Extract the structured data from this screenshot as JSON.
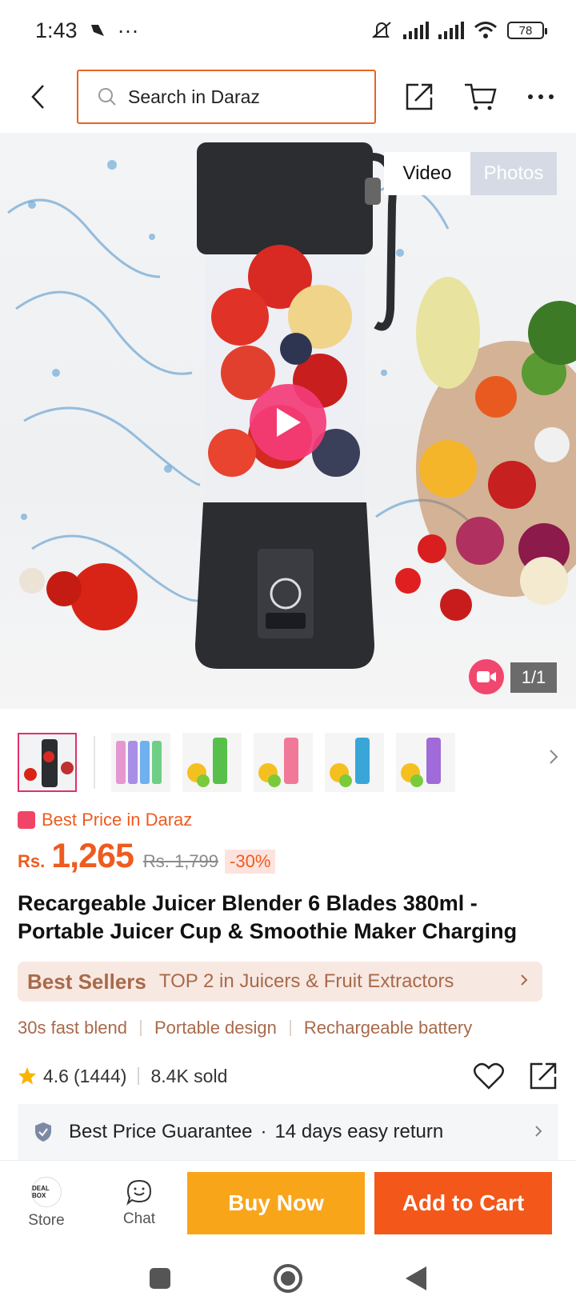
{
  "status_bar": {
    "time": "1:43",
    "dots": "···",
    "battery": "78"
  },
  "search": {
    "placeholder": "Search in Daraz"
  },
  "media": {
    "tab_video": "Video",
    "tab_photos": "Photos",
    "counter": "1/1"
  },
  "price_tag": "Best Price in Daraz",
  "price": {
    "currency": "Rs.",
    "current": "1,265",
    "original": "Rs. 1,799",
    "discount": "-30%"
  },
  "product": {
    "title": "Recargeable Juicer Blender 6 Blades 380ml - Portable Juicer Cup & Smoothie Maker Charging"
  },
  "best_sellers": {
    "label": "Best Sellers",
    "text": "TOP 2 in Juicers & Fruit Extractors"
  },
  "features": [
    "30s fast blend",
    "Portable design",
    "Rechargeable battery"
  ],
  "rating": {
    "score": "4.6",
    "count": "(1444)",
    "sold": "8.4K sold"
  },
  "guarantee": {
    "text1": "Best Price Guarantee",
    "separator": "·",
    "text2": "14 days easy return"
  },
  "bottom_bar": {
    "store": "Store",
    "store_logo": "DEAL BOX",
    "chat": "Chat",
    "buy_now": "Buy Now",
    "add_to_cart": "Add to Cart"
  },
  "colors": {
    "accent": "#f3571a",
    "buy": "#f9a51a",
    "pink": "#f1476f",
    "bestseller": "#a86a4a"
  },
  "thumbnails": [
    "black",
    "multi",
    "green",
    "pink",
    "blue",
    "purple"
  ]
}
